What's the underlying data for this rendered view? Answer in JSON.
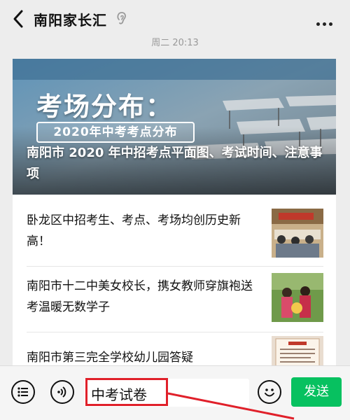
{
  "header": {
    "title": "南阳家长汇",
    "back_icon": "chevron-left-icon",
    "ear_icon": "ear-icon",
    "more_icon": "more-dots-icon"
  },
  "message_time": "周二 20:13",
  "article": {
    "banner": {
      "heading": "考场分布：",
      "subheading": "2020年中考考点分布",
      "title": "南阳市 2020 年中招考点平面图、考试时间、注意事项"
    },
    "items": [
      {
        "text": "卧龙区中招考生、考点、考场均创历史新高！",
        "thumb": "photo-meeting"
      },
      {
        "text": "南阳市十二中美女校长，携女教师穿旗袍送考温暖无数学子",
        "thumb": "photo-teachers"
      },
      {
        "text": "南阳市第三完全学校幼儿园答疑",
        "thumb": "photo-notice"
      }
    ]
  },
  "input_bar": {
    "menu_icon": "menu-list-icon",
    "voice_icon": "voice-icon",
    "input_value": "中考试卷",
    "emoji_icon": "emoji-icon",
    "send_label": "发送"
  },
  "colors": {
    "send_green": "#07c160",
    "highlight_red": "#e0202a",
    "background": "#ededed"
  }
}
